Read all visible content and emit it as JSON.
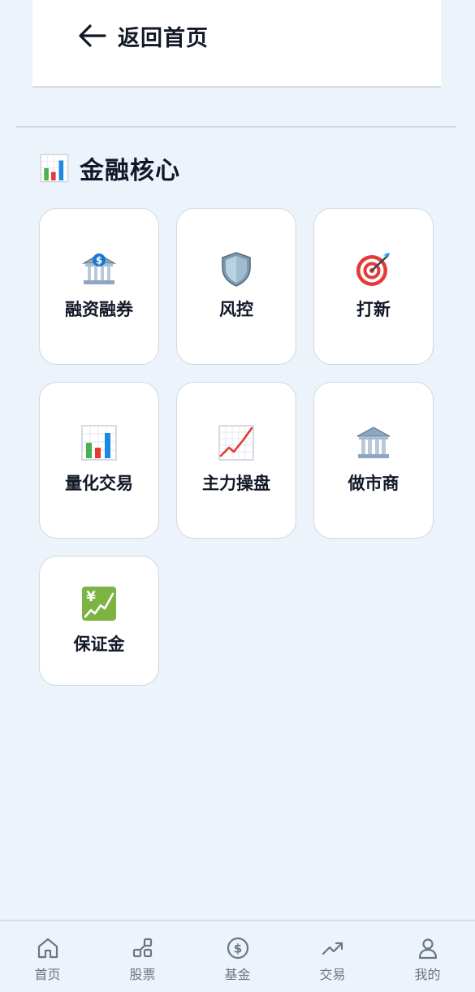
{
  "header": {
    "back_label": "返回首页"
  },
  "section": {
    "icon": "bar-chart-icon",
    "title": "金融核心"
  },
  "tiles": [
    {
      "label": "融资融券",
      "icon": "bank-dollar-icon"
    },
    {
      "label": "风控",
      "icon": "shield-icon"
    },
    {
      "label": "打新",
      "icon": "target-icon"
    },
    {
      "label": "量化交易",
      "icon": "bar-chart-icon"
    },
    {
      "label": "主力操盘",
      "icon": "chart-increasing-icon"
    },
    {
      "label": "做市商",
      "icon": "classical-building-icon"
    },
    {
      "label": "保证金",
      "icon": "chart-yen-icon"
    }
  ],
  "tabbar": {
    "items": [
      {
        "label": "首页",
        "icon": "home-icon"
      },
      {
        "label": "股票",
        "icon": "shapes-icon"
      },
      {
        "label": "基金",
        "icon": "dollar-circle-icon"
      },
      {
        "label": "交易",
        "icon": "trending-up-icon"
      },
      {
        "label": "我的",
        "icon": "user-icon"
      }
    ]
  },
  "colors": {
    "background": "#edf3fb",
    "card": "#ffffff",
    "border": "#cfd8e2",
    "tab_inactive": "#6b7685"
  }
}
